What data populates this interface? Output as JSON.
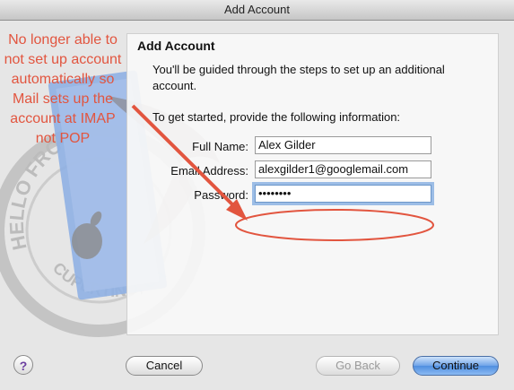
{
  "window": {
    "title": "Add Account"
  },
  "panel": {
    "heading": "Add Account",
    "intro": "You'll be guided through the steps to set up an additional account.",
    "get_started": "To get started, provide the following information:"
  },
  "form": {
    "full_name_label": "Full Name:",
    "full_name_value": "Alex Gilder",
    "email_label": "Email Address:",
    "email_value": "alexgilder1@googlemail.com",
    "password_label": "Password:",
    "password_value": "••••••••"
  },
  "annotation": {
    "text": "No longer able to not set up account automatically so Mail sets up the account at IMAP not POP",
    "color": "#e2553f"
  },
  "stamp": {
    "top_text": "HELLO FRO",
    "bottom_text": "CUPERTINO, CA"
  },
  "buttons": {
    "help": "?",
    "cancel": "Cancel",
    "go_back": "Go Back",
    "continue": "Continue"
  }
}
